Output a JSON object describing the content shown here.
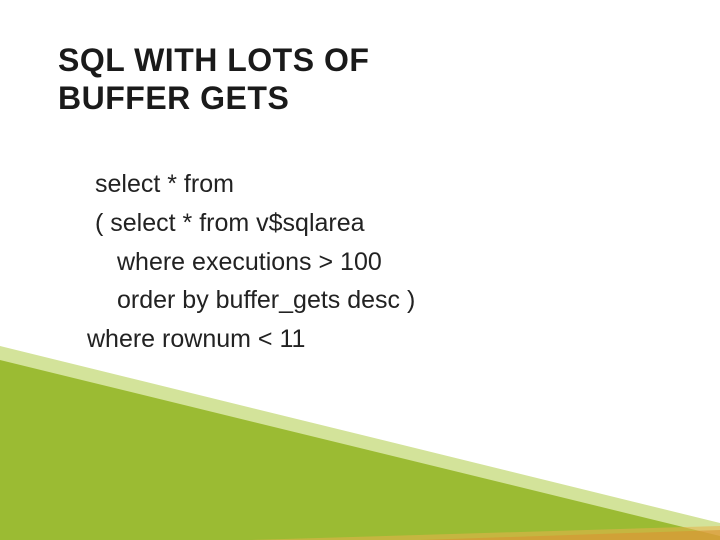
{
  "title_line1": "SQL WITH LOTS OF",
  "title_line2": "BUFFER GETS",
  "code": {
    "l1": "select * from",
    "l2": "( select * from v$sqlarea",
    "l3": "where executions > 100",
    "l4": "order by buffer_gets desc )",
    "l5": "where rownum < 11"
  }
}
